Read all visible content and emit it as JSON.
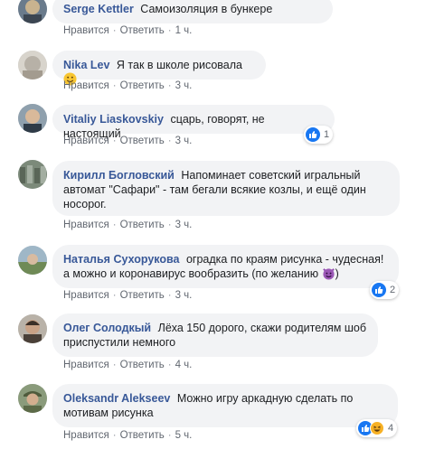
{
  "comments": [
    {
      "author": "Serge Kettler",
      "text": "Самоизоляция в бункере",
      "like": "Нравится",
      "reply": "Ответить",
      "time": "1 ч."
    },
    {
      "author": "Nika Lev",
      "text": "Я так в школе рисовала",
      "like": "Нравится",
      "reply": "Ответить",
      "time": "3 ч."
    },
    {
      "author": "Vitaliy Liaskovskiy",
      "text": "сцарь, говорят, не настоящий",
      "like": "Нравится",
      "reply": "Ответить",
      "time": "3 ч.",
      "reactions": "1"
    },
    {
      "author": "Кирилл Богловский",
      "text": "Напоминает советский игральный автомат \"Сафари\" - там бегали всякие козлы, и ещё один носорог.",
      "like": "Нравится",
      "reply": "Ответить",
      "time": "3 ч."
    },
    {
      "author": "Наталья Сухорукова",
      "text": "оградка по краям рисунка - чудесная! а можно и коронавирус вообразить (по желанию",
      "like": "Нравится",
      "reply": "Ответить",
      "time": "3 ч.",
      "reactions": "2"
    },
    {
      "author": "Олег Солодкый",
      "text": "Лёха 150 дорого, скажи родителям шоб приспустили немного",
      "like": "Нравится",
      "reply": "Ответить",
      "time": "4 ч."
    },
    {
      "author": "Oleksandr Alekseev",
      "text": "Можно игру аркадную сделать по мотивам рисунка",
      "like": "Нравится",
      "reply": "Ответить",
      "time": "5 ч.",
      "reactions": "4"
    }
  ],
  "colors": {
    "author": "#385898",
    "bubble": "#f2f3f5",
    "meta": "#616770",
    "like": "#1877f2",
    "haha": "#f7b125"
  },
  "icons": [
    "avatar",
    "like-icon",
    "haha-icon",
    "smile-emoji",
    "devil-emoji"
  ]
}
